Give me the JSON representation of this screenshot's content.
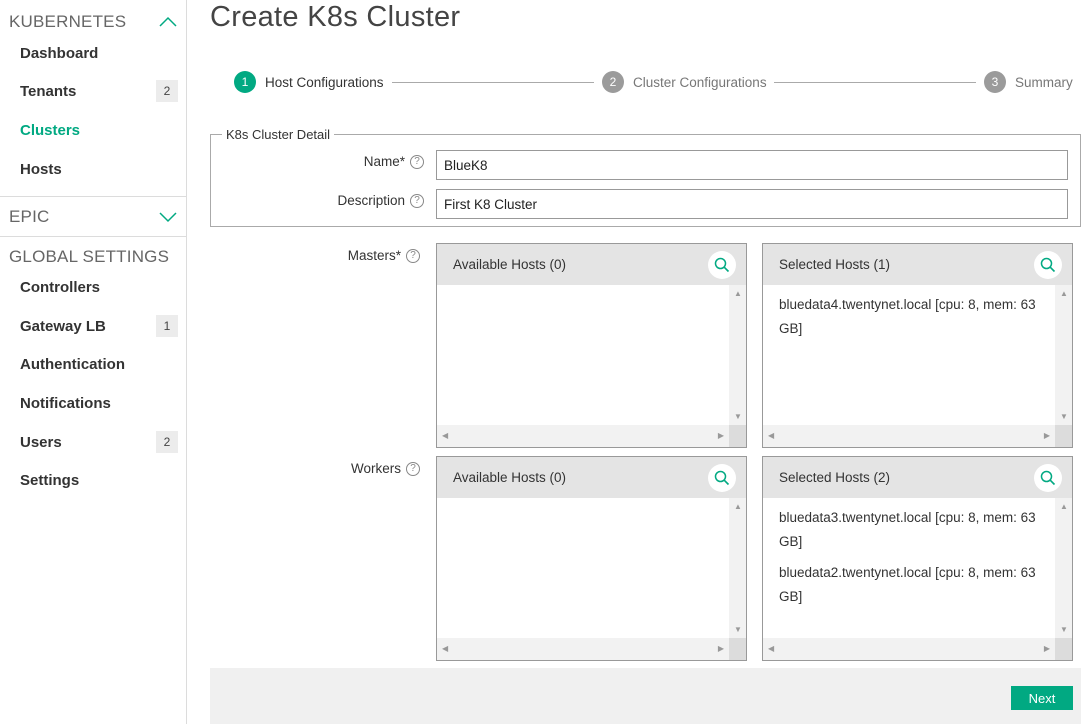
{
  "sidebar": {
    "kubernetes": {
      "title": "KUBERNETES",
      "items": [
        {
          "label": "Dashboard"
        },
        {
          "label": "Tenants",
          "badge": "2"
        },
        {
          "label": "Clusters"
        },
        {
          "label": "Hosts"
        }
      ]
    },
    "epic": {
      "title": "EPIC"
    },
    "global": {
      "title": "GLOBAL SETTINGS",
      "items": [
        {
          "label": "Controllers"
        },
        {
          "label": "Gateway LB",
          "badge": "1"
        },
        {
          "label": "Authentication"
        },
        {
          "label": "Notifications"
        },
        {
          "label": "Users",
          "badge": "2"
        },
        {
          "label": "Settings"
        }
      ]
    }
  },
  "page": {
    "title": "Create K8s Cluster"
  },
  "steps": [
    {
      "number": "1",
      "label": "Host Configurations"
    },
    {
      "number": "2",
      "label": "Cluster Configurations"
    },
    {
      "number": "3",
      "label": "Summary"
    }
  ],
  "detail": {
    "legend": "K8s Cluster Detail",
    "name_label": "Name*",
    "name_value": "BlueK8",
    "description_label": "Description",
    "description_value": "First K8 Cluster"
  },
  "masters": {
    "label": "Masters*",
    "available_header": "Available Hosts (0)",
    "selected_header": "Selected Hosts (1)",
    "selected": [
      "bluedata4.twentynet.local [cpu: 8, mem: 63 GB]"
    ]
  },
  "workers": {
    "label": "Workers",
    "available_header": "Available Hosts (0)",
    "selected_header": "Selected Hosts (2)",
    "selected": [
      "bluedata3.twentynet.local [cpu: 8, mem: 63 GB]",
      "bluedata2.twentynet.local [cpu: 8, mem: 63 GB]"
    ]
  },
  "footer": {
    "next_label": "Next"
  },
  "colors": {
    "accent": "#01a982",
    "step_inactive": "#9b9b9b"
  },
  "icons": {
    "search": "search-icon",
    "help": "help-circle-icon",
    "chevron_up": "chevron-up-icon",
    "chevron_down": "chevron-down-icon"
  }
}
